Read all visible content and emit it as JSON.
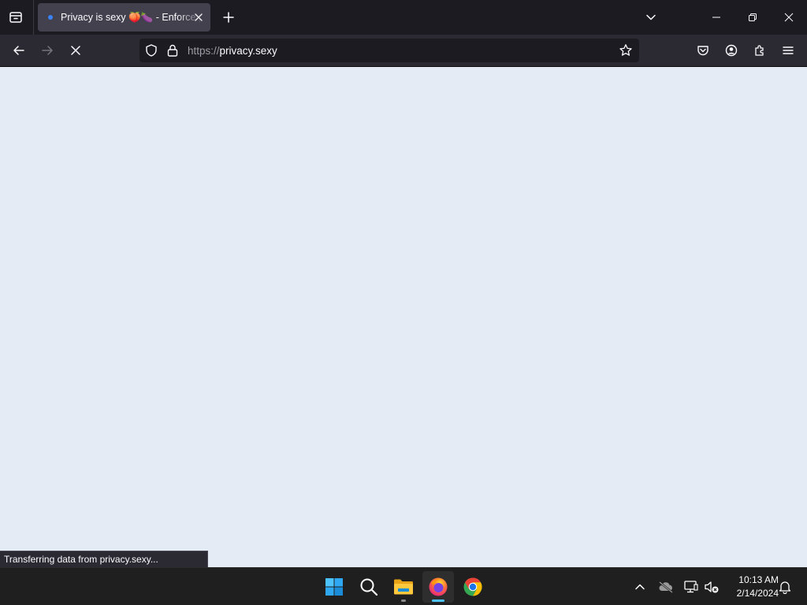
{
  "tab": {
    "title": "Privacy is sexy 🍑🍆 - Enforce privacy & security best-practices on Windows, macOS and Linux"
  },
  "urlbar": {
    "scheme": "https://",
    "host": "privacy.sexy"
  },
  "status": {
    "text": "Transferring data from privacy.sexy..."
  },
  "taskbar": {
    "apps": [
      "start-button",
      "search",
      "file-explorer",
      "firefox",
      "chrome"
    ],
    "clock": {
      "time": "10:13 AM",
      "date": "2/14/2024"
    }
  },
  "colors": {
    "content_bg": "#e5ebf4",
    "toolbar_bg": "#2b2a33",
    "tabstrip_bg": "#1c1b22",
    "active_indicator": "#4cc2ff"
  }
}
